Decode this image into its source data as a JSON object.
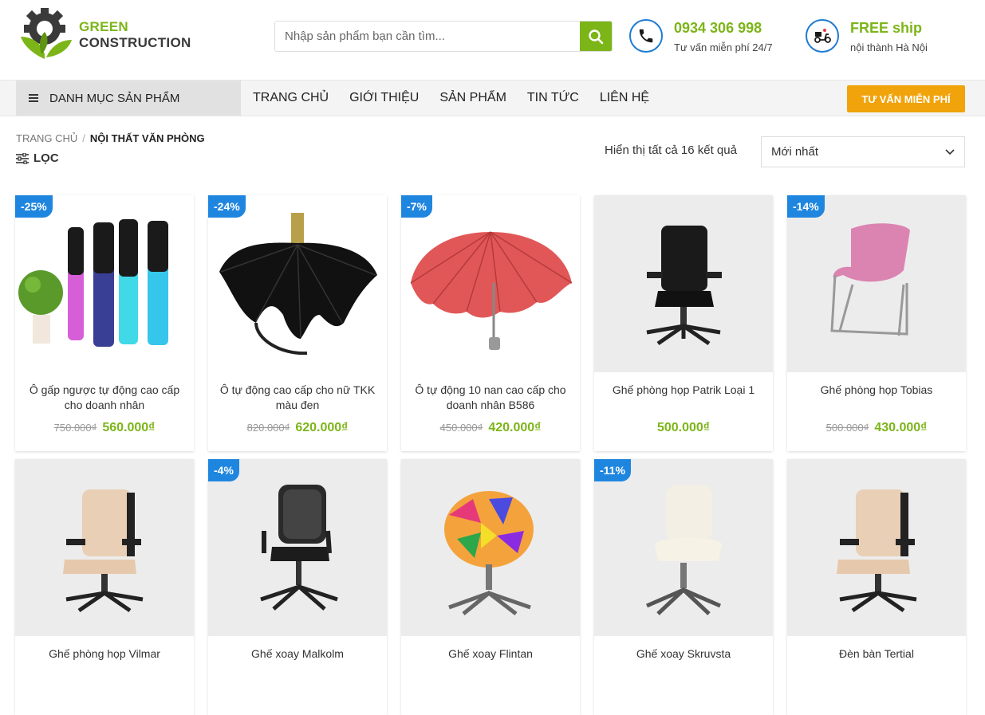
{
  "header": {
    "logo_line1": "GREEN",
    "logo_line2": "CONSTRUCTION",
    "search_placeholder": "Nhập sản phẩm bạn cần tìm...",
    "phone": "0934 306 998",
    "phone_sub": "Tư vấn miễn phí 24/7",
    "ship": "FREE ship",
    "ship_sub": "nội thành Hà Nội"
  },
  "nav": {
    "category_label": "DANH MỤC SẢN PHẨM",
    "items": [
      "TRANG CHỦ",
      "GIỚI THIỆU",
      "SẢN PHẨM",
      "TIN TỨC",
      "LIÊN HỆ"
    ],
    "cta": "TƯ VẤN MIỄN PHÍ"
  },
  "toolbar": {
    "breadcrumb_home": "TRANG CHỦ",
    "breadcrumb_sep": "/",
    "breadcrumb_current": "NỘI THẤT VĂN PHÒNG",
    "filter_label": "LỌC",
    "result_count": "Hiển thị tất cả 16 kết quả",
    "sort_value": "Mới nhất"
  },
  "products": [
    {
      "badge": "-25%",
      "name": "Ô gấp ngược tự động cao cấp cho doanh nhân",
      "old_price": "750.000₫",
      "price": "560.000₫",
      "icon": "folded-umbrellas-icon"
    },
    {
      "badge": "-24%",
      "name": "Ô tự động cao cấp cho nữ TKK màu đen",
      "old_price": "820.000₫",
      "price": "620.000₫",
      "icon": "black-umbrella-icon"
    },
    {
      "badge": "-7%",
      "name": "Ô tự động 10 nan cao cấp cho doanh nhân B586",
      "old_price": "450.000₫",
      "price": "420.000₫",
      "icon": "red-umbrella-icon"
    },
    {
      "badge": "",
      "name": "Ghế phòng họp Patrik Loại 1",
      "old_price": "",
      "price": "500.000₫",
      "icon": "office-chair-icon"
    },
    {
      "badge": "-14%",
      "name": "Ghế phòng họp Tobias",
      "old_price": "500.000₫",
      "price": "430.000₫",
      "icon": "pink-chair-icon"
    },
    {
      "badge": "",
      "name": "Ghế phòng họp Vilmar",
      "old_price": "",
      "price": "",
      "icon": "beige-chair-icon"
    },
    {
      "badge": "-4%",
      "name": "Ghế xoay Malkolm",
      "old_price": "",
      "price": "",
      "icon": "mesh-chair-icon"
    },
    {
      "badge": "",
      "name": "Ghế xoay Flintan",
      "old_price": "",
      "price": "",
      "icon": "colorful-chair-icon"
    },
    {
      "badge": "-11%",
      "name": "Ghế xoay Skruvsta",
      "old_price": "",
      "price": "",
      "icon": "white-chair-icon"
    },
    {
      "badge": "",
      "name": "Đèn bàn Tertial",
      "old_price": "",
      "price": "",
      "icon": "beige-chair-icon"
    }
  ]
}
